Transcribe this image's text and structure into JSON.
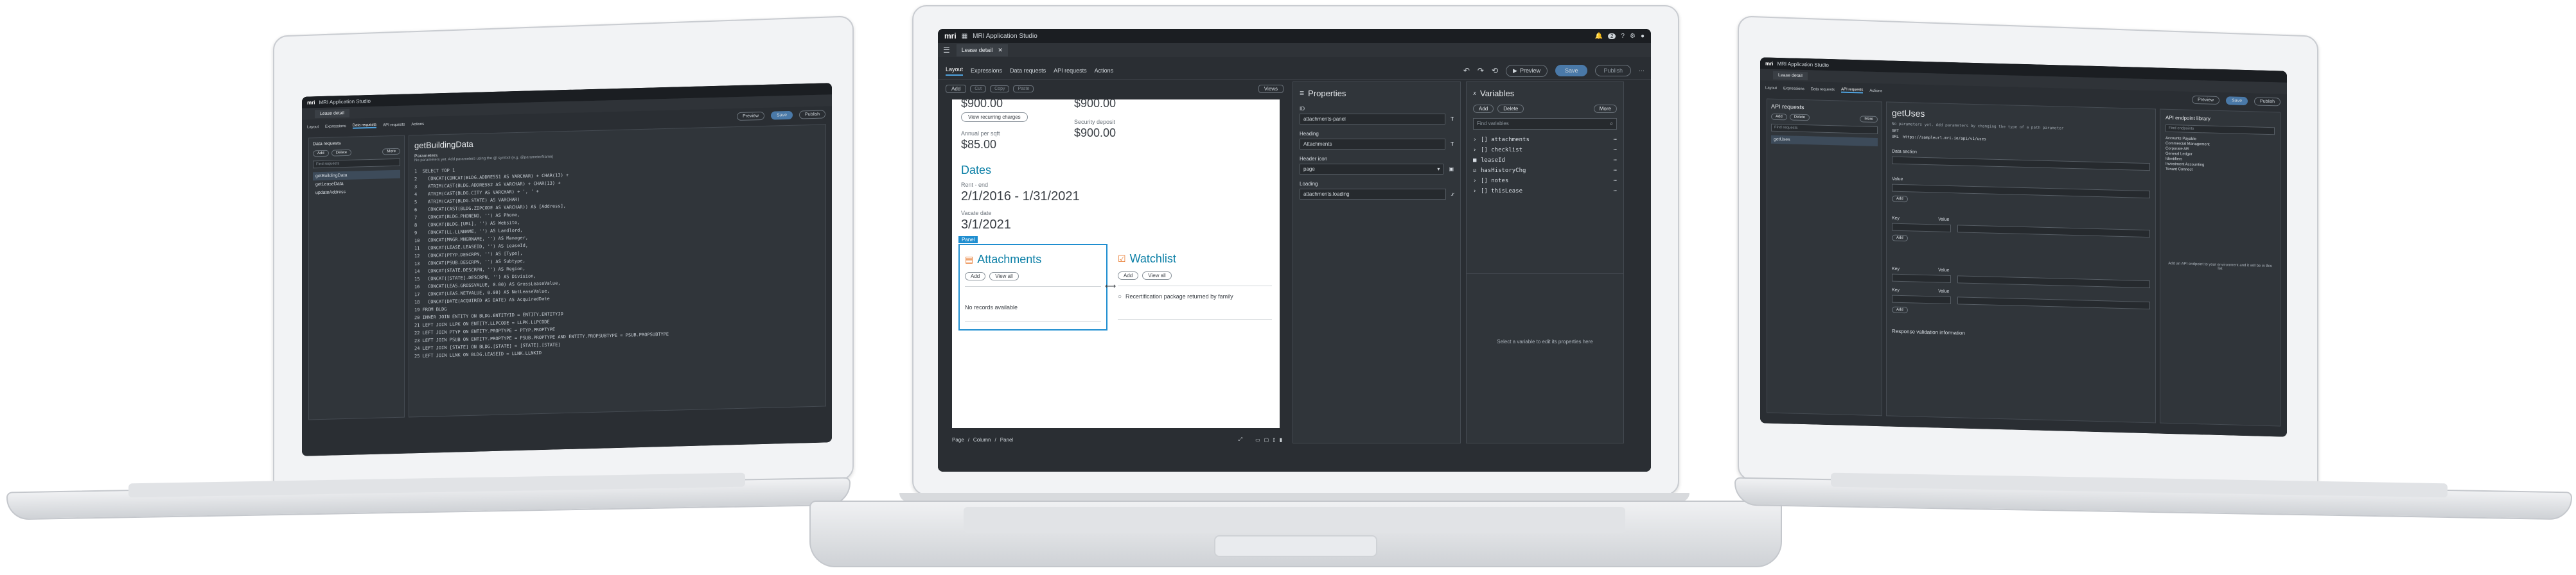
{
  "brand": "mri",
  "app_title": "MRI Application Studio",
  "header_badge": "2",
  "center": {
    "doc_tab": "Lease detail",
    "nav_tabs": [
      "Layout",
      "Expressions",
      "Data requests",
      "API requests",
      "Actions"
    ],
    "actions": {
      "preview": "Preview",
      "save": "Save",
      "publish": "Publish"
    },
    "toolbar": {
      "add": "Add",
      "cut": "Cut",
      "copy": "Copy",
      "paste": "Paste",
      "views": "Views"
    },
    "canvas": {
      "top_left_amount": "$900.00",
      "top_right_amount": "$900.00",
      "view_recurring": "View recurring charges",
      "annual_label": "Annual per sqft",
      "annual_value": "$85.00",
      "security_label": "Security deposit",
      "security_value": "$900.00",
      "dates_heading": "Dates",
      "rent_label": "Rent - end",
      "rent_value": "2/1/2016 - 1/31/2021",
      "vacate_label": "Vacate date",
      "vacate_value": "3/1/2021",
      "panel_badge": "Panel",
      "attachments_title": "Attachments",
      "attachments_add": "Add",
      "attachments_view": "View all",
      "no_records": "No records available",
      "watchlist_title": "Watchlist",
      "watchlist_add": "Add",
      "watchlist_view": "View all",
      "watchlist_item": "Recertification package returned by family"
    },
    "breadcrumb": [
      "Page",
      "Column",
      "Panel"
    ],
    "properties": {
      "title": "Properties",
      "id_label": "ID",
      "id_value": "attachments-panel",
      "heading_label": "Heading",
      "heading_value": "Attachments",
      "icon_label": "Header icon",
      "icon_value": "page",
      "loading_label": "Loading",
      "loading_value": "attachments.loading"
    },
    "variables": {
      "title": "Variables",
      "add": "Add",
      "delete": "Delete",
      "more": "More",
      "search_placeholder": "Find variables",
      "items": [
        "[] attachments",
        "[] checklist",
        "leaseId",
        "hasHistoryChg",
        "[] notes",
        "[] thisLease"
      ],
      "empty_hint": "Select a variable to edit its properties here"
    }
  },
  "left": {
    "doc_tab": "Lease detail",
    "nav_tabs": [
      "Layout",
      "Expressions",
      "Data requests",
      "API requests",
      "Actions"
    ],
    "actions": {
      "preview": "Preview",
      "save": "Save",
      "publish": "Publish"
    },
    "sidebar_title": "Data requests",
    "sidebar_add": "Add",
    "sidebar_delete": "Delete",
    "sidebar_more": "More",
    "sidebar_search": "Find requests",
    "sidebar_items": [
      "getBuildingData",
      "getLeaseData",
      "updateAddress"
    ],
    "query_title": "getBuildingData",
    "params_label": "Parameters",
    "params_hint": "No parameters yet. Add parameters using the @ symbol (e.g. @parameterName)",
    "code": [
      "1  SELECT TOP 1",
      "2    CONCAT(CONCAT(BLDG.ADDRESS1 AS VARCHAR) + CHAR(13) +",
      "3    ATRIM(CAST(BLDG.ADDRESS2 AS VARCHAR) + CHAR(13) +",
      "4    ATRIM(CAST(BLDG.CITY AS VARCHAR) + ', ' +",
      "5    ATRIM(CAST(BLDG.STATE) AS VARCHAR)",
      "6    CONCAT(CAST(BLDG.ZIPCODE AS VARCHAR)) AS [Address],",
      "7    CONCAT(BLDG.PHONENO, '') AS Phone,",
      "8    CONCAT(BLDG.[URL], '') AS Website,",
      "9    CONCAT(LL.LLNNAME, '') AS Landlord,",
      "10   CONCAT(MNGR.MNGRNAME, '') AS Manager,",
      "11   CONCAT(LEASE.LEASEID, '') AS LeaseId,",
      "12   CONCAT(PTYP.DESCRPN, '') AS [Type],",
      "13   CONCAT(PSUB.DESCRPN, '') AS Subtype,",
      "14   CONCAT(STATE.DESCRPN, '') AS Region,",
      "15   CONCAT([STATE].DESCRPN, '') AS Division,",
      "16   CONCAT(LEAS.GROSSVALUE, 0.00) AS GrossLeaseValue,",
      "17   CONCAT(LEAS.NETVALUE, 0.00) AS NetLeaseValue,",
      "18   CONCAT(DATE(ACQUIRED AS DATE) AS AcquiredDate",
      "19 FROM BLDG",
      "20 INNER JOIN ENTITY ON BLDG.ENTITYID = ENTITY.ENTITYID",
      "21 LEFT JOIN LLPK ON ENTITY.LLPCODE = LLPK.LLPCODE",
      "22 LEFT JOIN PTYP ON ENTITY.PROPTYPE = PTYP.PROPTYPE",
      "23 LEFT JOIN PSUB ON ENTITY.PROPTYPE = PSUB.PROPTYPE AND ENTITY.PROPSUBTYPE = PSUB.PROPSUBTYPE",
      "24 LEFT JOIN [STATE] ON BLDG.[STATE] = [STATE].[STATE]",
      "25 LEFT JOIN LLNK ON BLDG.LEASEID = LLNK.LLNKID"
    ]
  },
  "right": {
    "doc_tab": "Lease detail",
    "nav_tabs": [
      "Layout",
      "Expressions",
      "Data requests",
      "API requests",
      "Actions"
    ],
    "actions": {
      "preview": "Preview",
      "save": "Save",
      "publish": "Publish"
    },
    "sidebar_title": "API requests",
    "sidebar_add": "Add",
    "sidebar_delete": "Delete",
    "sidebar_more": "More",
    "sidebar_search": "Find requests",
    "sidebar_items": [
      "getUses"
    ],
    "request_title": "getUses",
    "params_hint": "No parameters yet. Add parameters by changing the type of a path parameter",
    "method": "GET",
    "url_label": "URL",
    "url_value": "https://sampleurl.mri.io/api/v1/uses",
    "data_section": "Data section",
    "key_label": "Key",
    "value_label": "Value",
    "add_label": "Add",
    "response_validation": "Response validation information",
    "library_title": "API endpoint library",
    "library_search": "Find endpoints",
    "library_items": [
      "Accounts Payable",
      "Commercial Management",
      "Corporate AR",
      "General Ledger",
      "Identifiers",
      "Investment Accounting",
      "Tenant Connect"
    ],
    "library_hint": "Add an API endpoint to your environment and it will be in this list"
  },
  "colors": {
    "accent": "#4fa3e0",
    "teal": "#0b7fa6",
    "orange": "#e8782c",
    "dark": "#2a2e33"
  }
}
